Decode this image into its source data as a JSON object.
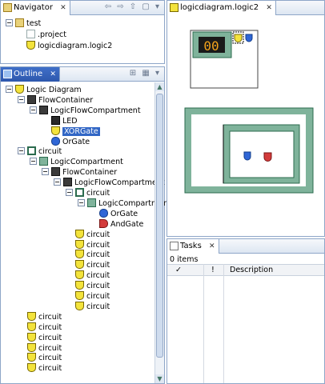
{
  "navigator": {
    "tab_label": "Navigator",
    "tree": [
      {
        "label": "test",
        "icon": "folder-icon"
      },
      {
        "label": ".project",
        "icon": "file-icon"
      },
      {
        "label": "logicdiagram.logic2",
        "icon": "logic-file-icon"
      }
    ]
  },
  "outline": {
    "tab_label": "Outline",
    "tree": [
      {
        "label": "Logic Diagram"
      },
      {
        "label": "FlowContainer"
      },
      {
        "label": "LogicFlowCompartment"
      },
      {
        "label": "LED"
      },
      {
        "label": "XORGate",
        "selected": true
      },
      {
        "label": "OrGate"
      },
      {
        "label": "circuit"
      },
      {
        "label": "LogicCompartment"
      },
      {
        "label": "FlowContainer"
      },
      {
        "label": "LogicFlowCompartment"
      },
      {
        "label": "circuit"
      },
      {
        "label": "LogicCompartment"
      },
      {
        "label": "OrGate"
      },
      {
        "label": "AndGate"
      },
      {
        "label": "circuit"
      },
      {
        "label": "circuit"
      },
      {
        "label": "circuit"
      },
      {
        "label": "circuit"
      },
      {
        "label": "circuit"
      },
      {
        "label": "circuit"
      },
      {
        "label": "circuit"
      },
      {
        "label": "circuit"
      },
      {
        "label": "circuit"
      },
      {
        "label": "circuit"
      },
      {
        "label": "circuit"
      },
      {
        "label": "circuit"
      },
      {
        "label": "circuit"
      },
      {
        "label": "circuit"
      }
    ]
  },
  "editor": {
    "tab_label": "logicdiagram.logic2",
    "led_display": "00"
  },
  "tasks": {
    "tab_label": "Tasks",
    "count_text": "0 items",
    "columns": [
      "✓",
      "!",
      "Description"
    ]
  },
  "colors": {
    "accent": "#3166c5",
    "container_green": "#7fb39b"
  }
}
